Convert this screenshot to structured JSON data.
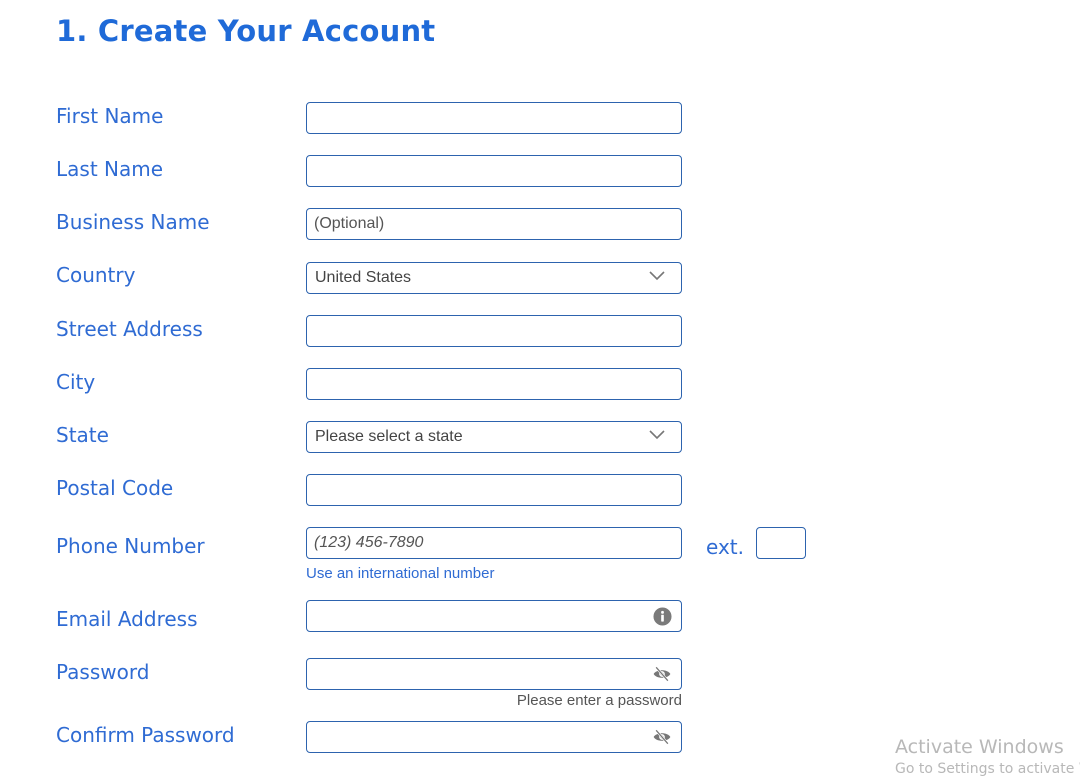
{
  "page": {
    "title": "1. Create Your Account",
    "accent_color": "#1f6ad8",
    "border_color": "#2d63ae"
  },
  "form": {
    "first_name": {
      "label": "First Name",
      "value": "",
      "placeholder": ""
    },
    "last_name": {
      "label": "Last Name",
      "value": "",
      "placeholder": ""
    },
    "business_name": {
      "label": "Business Name",
      "value": "",
      "placeholder": "(Optional)"
    },
    "country": {
      "label": "Country",
      "selected": "United States"
    },
    "street_address": {
      "label": "Street Address",
      "value": "",
      "placeholder": ""
    },
    "city": {
      "label": "City",
      "value": "",
      "placeholder": ""
    },
    "state": {
      "label": "State",
      "selected": "Please select a state"
    },
    "postal_code": {
      "label": "Postal Code",
      "value": "",
      "placeholder": ""
    },
    "phone": {
      "label": "Phone Number",
      "value": "",
      "placeholder": "(123) 456-7890",
      "international_link": "Use an international number",
      "ext_label": "ext.",
      "ext_value": ""
    },
    "email": {
      "label": "Email Address",
      "value": "",
      "icon": "info-icon"
    },
    "password": {
      "label": "Password",
      "value": "",
      "icon": "eye-slash-icon",
      "error": "Please enter a password"
    },
    "confirm_password": {
      "label": "Confirm Password",
      "value": "",
      "icon": "eye-slash-icon"
    }
  },
  "watermark": {
    "line1": "Activate Windows",
    "line2": "Go to Settings to activate W"
  }
}
